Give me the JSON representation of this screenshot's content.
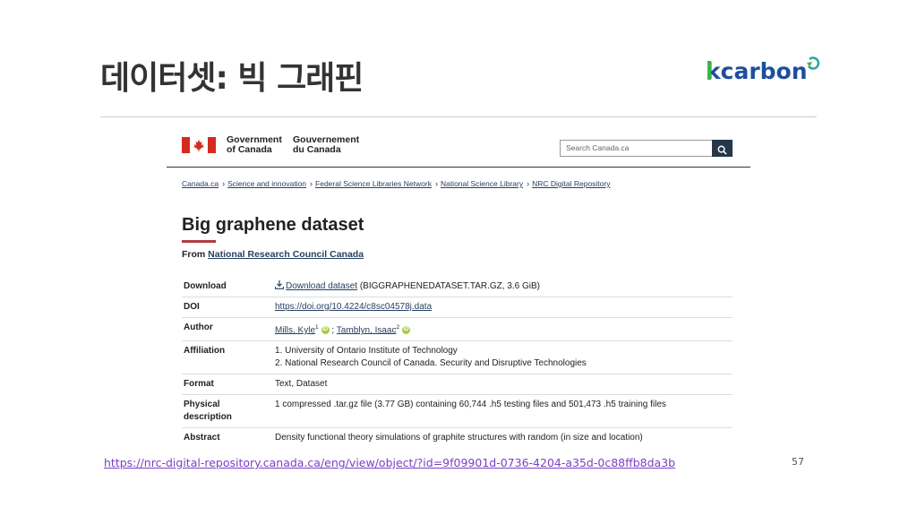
{
  "slide": {
    "title": "데이터셋: 빅 그래핀",
    "logo_text": "kcarbon",
    "source_url": "https://nrc-digital-repository.canada.ca/eng/view/object/?id=9f09901d-0736-4204-a35d-0c88ffb8da3b",
    "page_number": "57"
  },
  "header": {
    "gov_en_line1": "Government",
    "gov_en_line2": "of Canada",
    "gov_fr_line1": "Gouvernement",
    "gov_fr_line2": "du Canada",
    "search_placeholder": "Search Canada.ca"
  },
  "breadcrumb": [
    "Canada.ca",
    "Science and innovation",
    "Federal Science Libraries Network",
    "National Science Library",
    "NRC Digital Repository"
  ],
  "record": {
    "title": "Big graphene dataset",
    "from_label": "From",
    "from_link": "National Research Council Canada",
    "rows": {
      "download_label": "Download",
      "download_link": "Download dataset",
      "download_detail": " (BIGGRAPHENEDATASET.TAR.GZ, 3.6 GiB)",
      "doi_label": "DOI",
      "doi_link": "https://doi.org/10.4224/c8sc04578j.data",
      "author_label": "Author",
      "author1": "Mills, Kyle",
      "author1_sup": "1",
      "author_sep": " ; ",
      "author2": "Tamblyn, Isaac",
      "author2_sup": "2",
      "affiliation_label": "Affiliation",
      "affiliation1": "1. University of Ontario Institute of Technology",
      "affiliation2": "2. National Research Council of Canada. Security and Disruptive Technologies",
      "format_label": "Format",
      "format_value": "Text, Dataset",
      "physical_label_1": "Physical",
      "physical_label_2": "description",
      "physical_value": "1 compressed .tar.gz file (3.77 GB) containing 60,744 .h5 testing files and 501,473 .h5 training files",
      "abstract_label": "Abstract",
      "abstract_value": "Density functional theory simulations of graphite structures with random (in size and location)"
    }
  },
  "icons": {
    "orcid": "iD",
    "colors": {
      "canada_red": "#d52b1e",
      "gc_blue": "#26374a",
      "link": "#284162",
      "accent_rule": "#af3c43",
      "url_purple": "#7b3fc6",
      "orcid_green": "#a6ce39"
    }
  }
}
